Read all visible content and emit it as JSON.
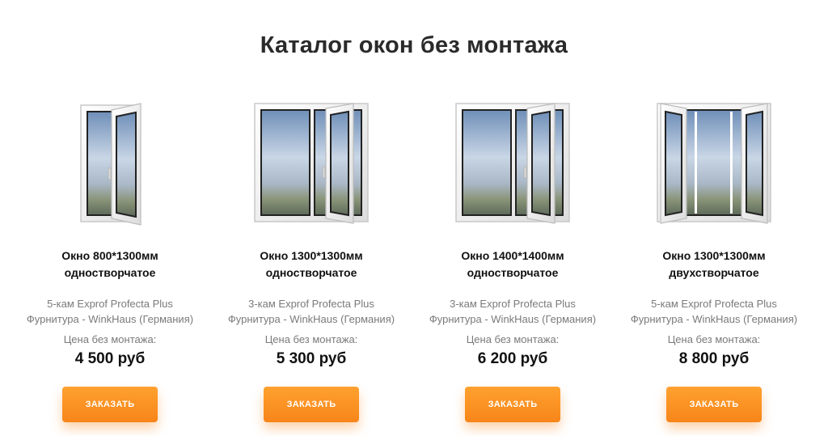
{
  "page": {
    "title": "Каталог окон без монтажа"
  },
  "colors": {
    "accent": "#f7851a",
    "text": "#111111",
    "muted": "#7a7a7a"
  },
  "products": [
    {
      "name_line1": "Окно 800*1300мм",
      "name_line2": "одностворчатое",
      "spec_line1": "5-кам Exprof Profecta Plus",
      "spec_line2": "Фурнитура - WinkHaus (Германия)",
      "price_label": "Цена без монтажа:",
      "price": "4 500 руб",
      "button_label": "ЗАКАЗАТЬ",
      "image": "single-sash-window-open"
    },
    {
      "name_line1": "Окно 1300*1300мм",
      "name_line2": "одностворчатое",
      "spec_line1": "3-кам Exprof Profecta Plus",
      "spec_line2": "Фурнитура - WinkHaus (Германия)",
      "price_label": "Цена без монтажа:",
      "price": "5 300 руб",
      "button_label": "ЗАКАЗАТЬ",
      "image": "two-pane-window-one-open"
    },
    {
      "name_line1": "Окно 1400*1400мм",
      "name_line2": "одностворчатое",
      "spec_line1": "3-кам Exprof Profecta Plus",
      "spec_line2": "Фурнитура - WinkHaus (Германия)",
      "price_label": "Цена без монтажа:",
      "price": "6 200 руб",
      "button_label": "ЗАКАЗАТЬ",
      "image": "two-pane-window-one-open"
    },
    {
      "name_line1": "Окно 1300*1300мм",
      "name_line2": "двухстворчатое",
      "spec_line1": "5-кам Exprof Profecta Plus",
      "spec_line2": "Фурнитура - WinkHaus (Германия)",
      "price_label": "Цена без монтажа:",
      "price": "8 800 руб",
      "button_label": "ЗАКАЗАТЬ",
      "image": "double-sash-window-open"
    }
  ]
}
